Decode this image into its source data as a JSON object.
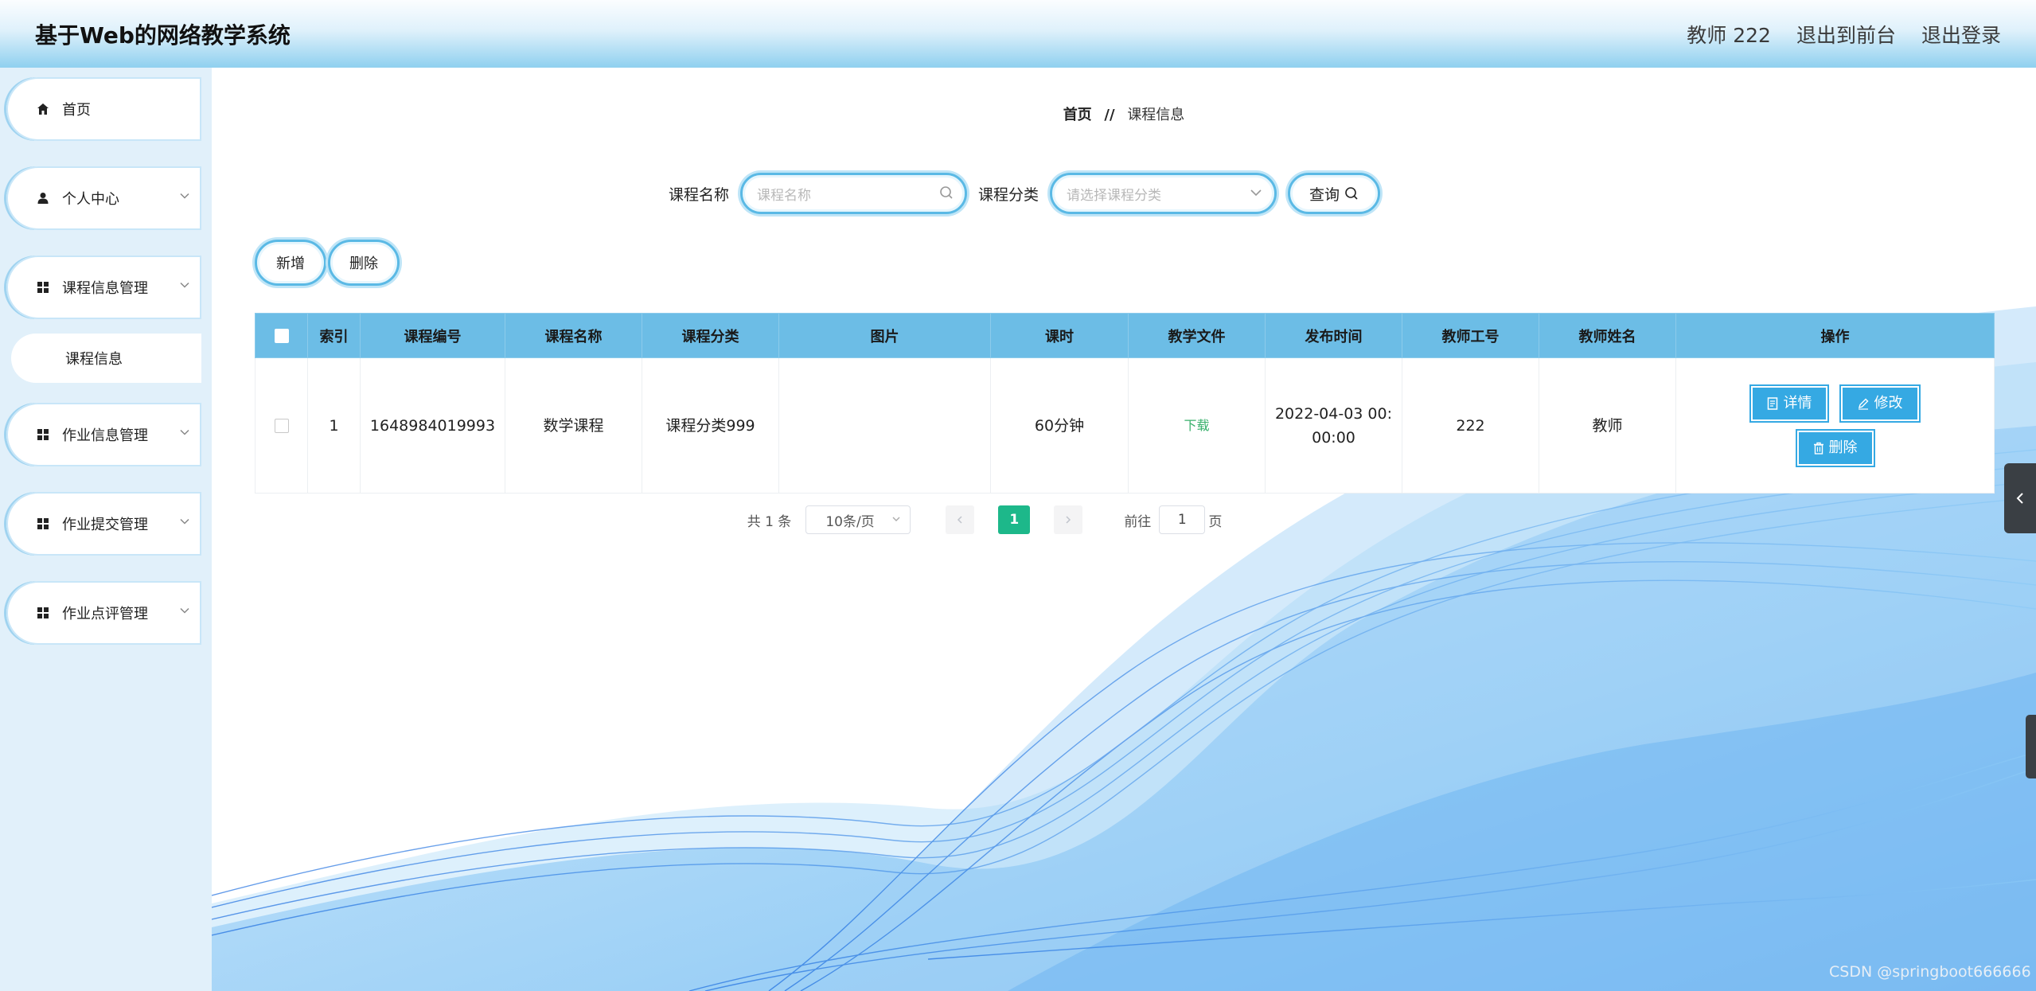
{
  "header": {
    "title": "基于Web的网络教学系统",
    "user": "教师 222",
    "back_front": "退出到前台",
    "logout": "退出登录"
  },
  "sidebar": {
    "items": [
      {
        "label": "首页",
        "icon": "home-icon"
      },
      {
        "label": "个人中心",
        "icon": "user-icon"
      },
      {
        "label": "课程信息管理",
        "icon": "grid-icon"
      },
      {
        "label": "课程信息"
      },
      {
        "label": "作业信息管理",
        "icon": "grid-icon"
      },
      {
        "label": "作业提交管理",
        "icon": "grid-icon"
      },
      {
        "label": "作业点评管理",
        "icon": "grid-icon"
      }
    ]
  },
  "breadcrumb": {
    "home": "首页",
    "separator": "//",
    "current": "课程信息"
  },
  "search": {
    "name_label": "课程名称",
    "name_placeholder": "课程名称",
    "category_label": "课程分类",
    "category_placeholder": "请选择课程分类",
    "query_label": "查询"
  },
  "actions": {
    "add_label": "新增",
    "delete_label": "删除"
  },
  "table": {
    "columns": [
      "索引",
      "课程编号",
      "课程名称",
      "课程分类",
      "图片",
      "课时",
      "教学文件",
      "发布时间",
      "教师工号",
      "教师姓名",
      "操作"
    ],
    "rows": [
      {
        "index": "1",
        "code": "1648984019993",
        "name": "数学课程",
        "category": "课程分类999",
        "image": "",
        "hours": "60分钟",
        "file": "下载",
        "publish_time_line1": "2022-04-03 00:",
        "publish_time_line2": "00:00",
        "teacher_id": "222",
        "teacher_name": "教师",
        "detail_label": "详情",
        "edit_label": "修改",
        "delete_label": "删除"
      }
    ]
  },
  "pagination": {
    "total": "共 1 条",
    "page_size": "10条/页",
    "current_page": "1",
    "goto_label": "前往",
    "goto_value": "1",
    "page_unit": "页"
  },
  "watermark": "CSDN @springboot666666",
  "colors": {
    "header_accent": "#8fd0ef",
    "table_header": "#6cbde6",
    "button_blue": "#35a9e3",
    "page_active": "#1db88a",
    "sidebar_bg": "#e1f0fa"
  }
}
